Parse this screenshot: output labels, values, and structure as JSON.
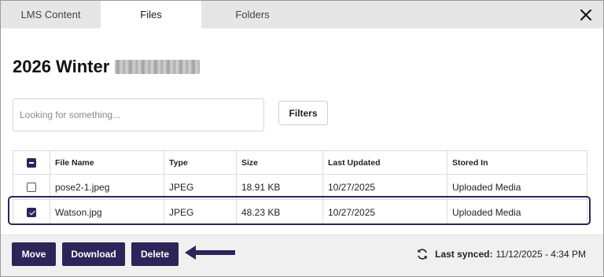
{
  "tabs": [
    {
      "label": "LMS Content",
      "active": false
    },
    {
      "label": "Files",
      "active": true
    },
    {
      "label": "Folders",
      "active": false
    }
  ],
  "close_icon": "close-icon",
  "page": {
    "title": "2026 Winter"
  },
  "search": {
    "placeholder": "Looking for something..."
  },
  "filters_label": "Filters",
  "table": {
    "headers": [
      "File Name",
      "Type",
      "Size",
      "Last Updated",
      "Stored In"
    ],
    "header_checkbox": "partial",
    "rows": [
      {
        "checked": false,
        "file_name": "pose2-1.jpeg",
        "type": "JPEG",
        "size": "18.91 KB",
        "last_updated": "10/27/2025",
        "stored_in": "Uploaded Media"
      },
      {
        "checked": true,
        "file_name": "Watson.jpg",
        "type": "JPEG",
        "size": "48.23 KB",
        "last_updated": "10/27/2025",
        "stored_in": "Uploaded Media"
      }
    ]
  },
  "actions": {
    "move": "Move",
    "download": "Download",
    "delete": "Delete"
  },
  "sync": {
    "label": "Last synced:",
    "value": "11/12/2025 - 4:34 PM",
    "icon": "sync-icon"
  },
  "colors": {
    "accent": "#2d2459",
    "tab_bar": "#e6e6e6",
    "footer": "#f0f0f0"
  }
}
